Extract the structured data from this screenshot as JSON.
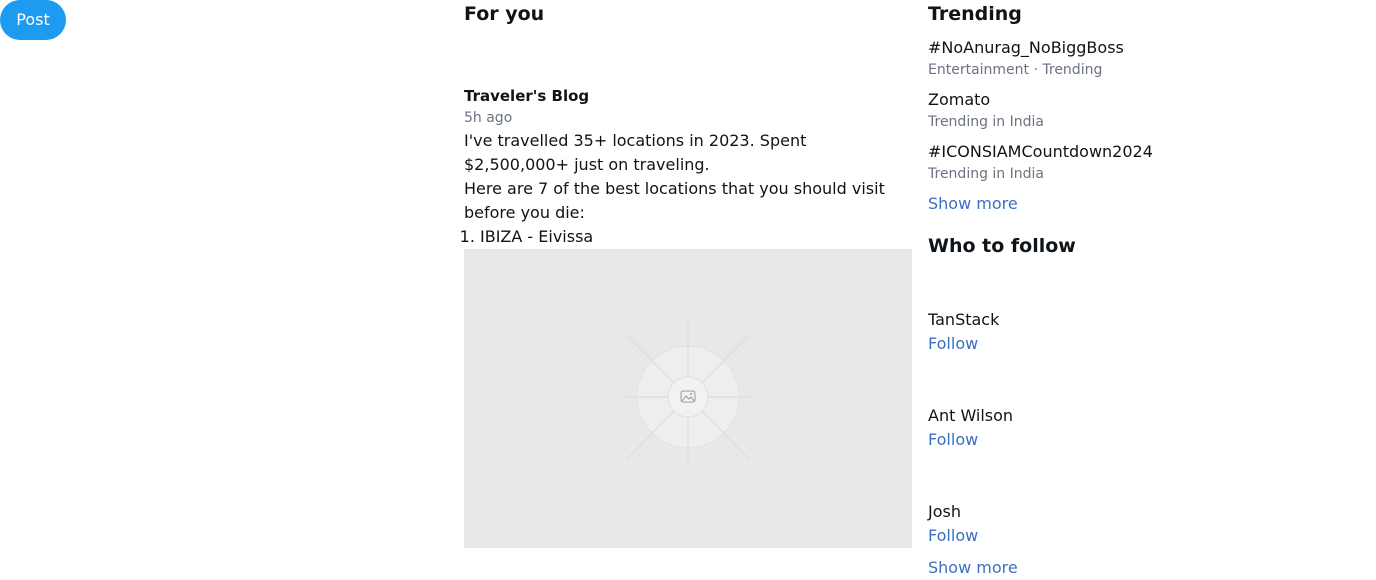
{
  "nav": {
    "post_label": "Post"
  },
  "feed": {
    "title": "For you",
    "post": {
      "author": "Traveler's Blog",
      "time": "5h ago",
      "line1": "I've travelled 35+ locations in 2023. Spent $2,500,000+ just on traveling.",
      "line2": "Here are 7 of the best locations that you should visit before you die:",
      "list": [
        "IBIZA - Eivissa"
      ],
      "media_icon": "image-placeholder-icon"
    }
  },
  "trending": {
    "title": "Trending",
    "items": [
      {
        "name": "#NoAnurag_NoBiggBoss",
        "meta": "Entertainment · Trending"
      },
      {
        "name": "Zomato",
        "meta": "Trending in India"
      },
      {
        "name": "#ICONSIAMCountdown2024",
        "meta": "Trending in India"
      }
    ],
    "show_more": "Show more"
  },
  "who_to_follow": {
    "title": "Who to follow",
    "items": [
      {
        "name": "TanStack",
        "action": "Follow"
      },
      {
        "name": "Ant Wilson",
        "action": "Follow"
      },
      {
        "name": "Josh",
        "action": "Follow"
      }
    ],
    "show_more": "Show more"
  },
  "colors": {
    "accent": "#1d9bf0",
    "link": "#3b6fc5",
    "muted": "#6b7280",
    "media_bg": "#e8e8e8"
  }
}
